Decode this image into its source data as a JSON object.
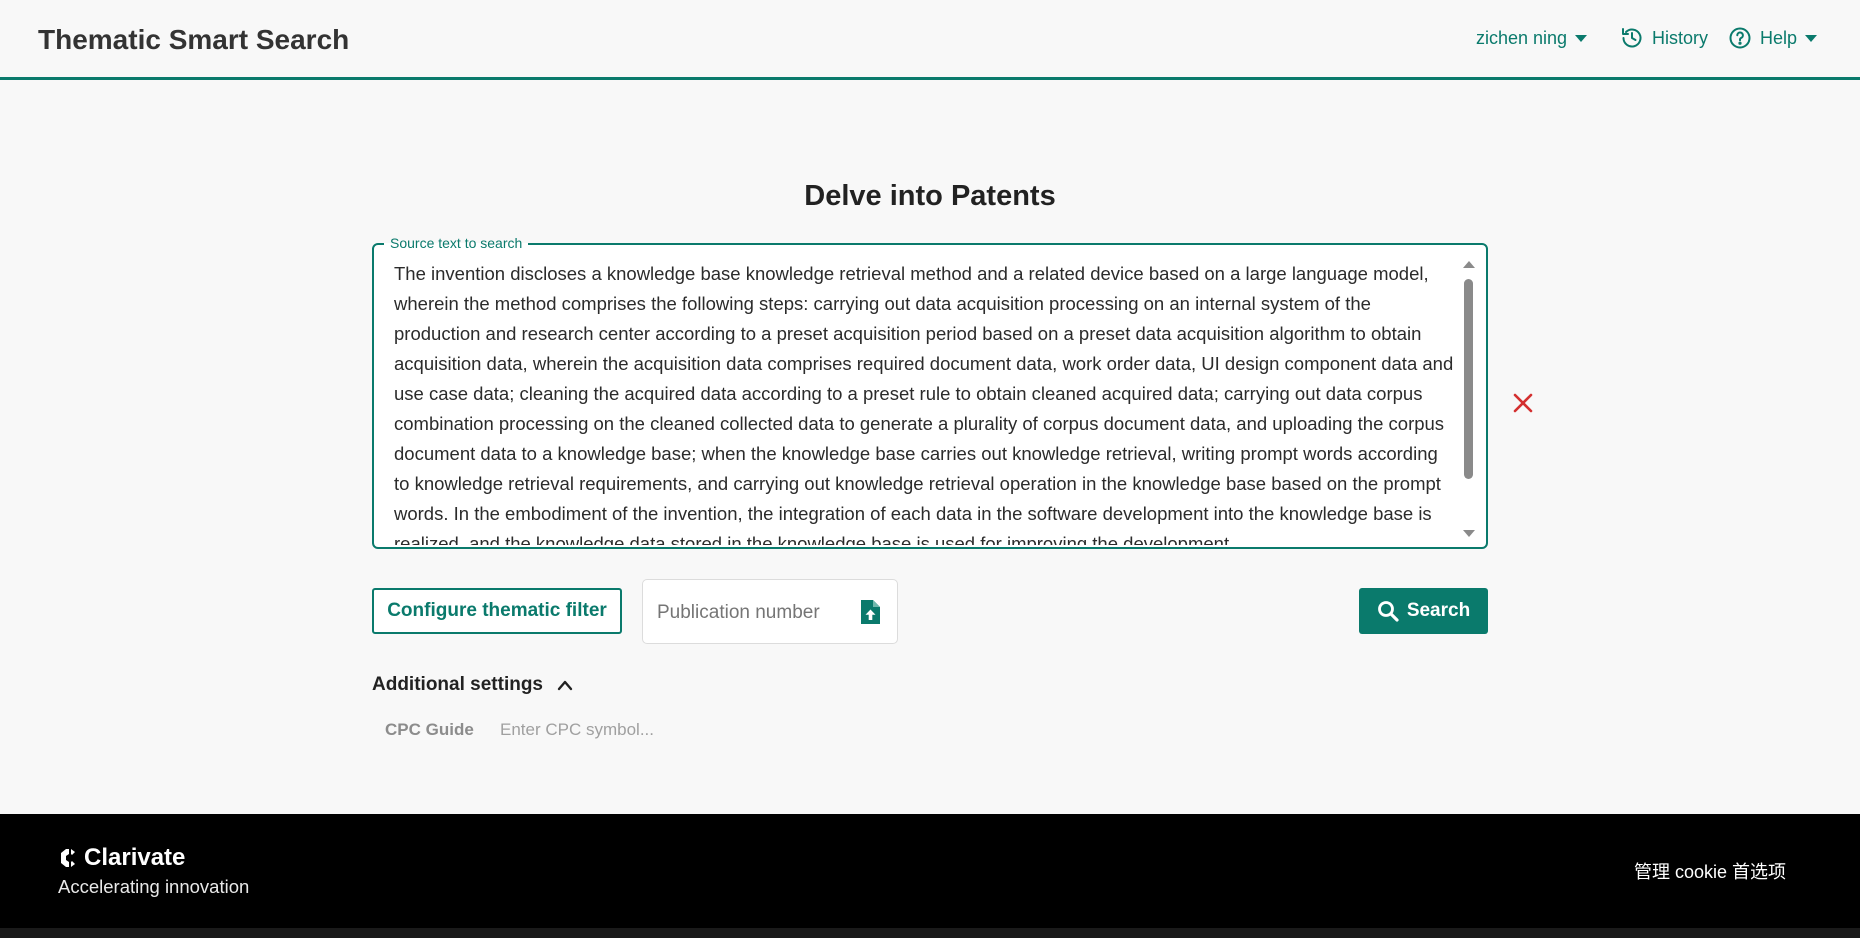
{
  "header": {
    "app_title": "Thematic Smart Search",
    "user_name": "zichen ning",
    "history_label": "History",
    "help_label": "Help"
  },
  "main": {
    "heading": "Delve into Patents",
    "source_label": "Source text to search",
    "source_text": "The invention discloses a knowledge base knowledge retrieval method and a related device based on a large language model, wherein the method comprises the following steps: carrying out data acquisition processing on an internal system of the production and research center according to a preset acquisition period based on a preset data acquisition algorithm to obtain acquisition data, wherein the acquisition data comprises required document data, work order data, UI design component data and use case data; cleaning the acquired data according to a preset rule to obtain cleaned acquired data; carrying out data corpus combination processing on the cleaned collected data to generate a plurality of corpus document data, and uploading the corpus document data to a knowledge base; when the knowledge base carries out knowledge retrieval, writing prompt words according to knowledge retrieval requirements, and carrying out knowledge retrieval operation in the knowledge base based on the prompt words. In the embodiment of the invention, the integration of each data in the software development into the knowledge base is realized, and the knowledge data stored in the knowledge base is used for improving the development",
    "configure_filter_label": "Configure thematic filter",
    "publication_placeholder": "Publication number",
    "search_label": "Search",
    "additional_settings_label": "Additional settings",
    "cpc_label": "CPC Guide",
    "cpc_placeholder": "Enter CPC symbol..."
  },
  "footer": {
    "brand": "Clarivate",
    "tagline": "Accelerating innovation",
    "cookie_label": "管理 cookie 首选项"
  },
  "colors": {
    "accent": "#0a7a6c",
    "clear_icon": "#d32f2f",
    "footer_bg": "#000000"
  },
  "icons": [
    "caret-down-icon",
    "history-icon",
    "help-icon",
    "close-icon",
    "upload-file-icon",
    "search-icon",
    "chevron-up-icon",
    "clarivate-logo-icon"
  ]
}
